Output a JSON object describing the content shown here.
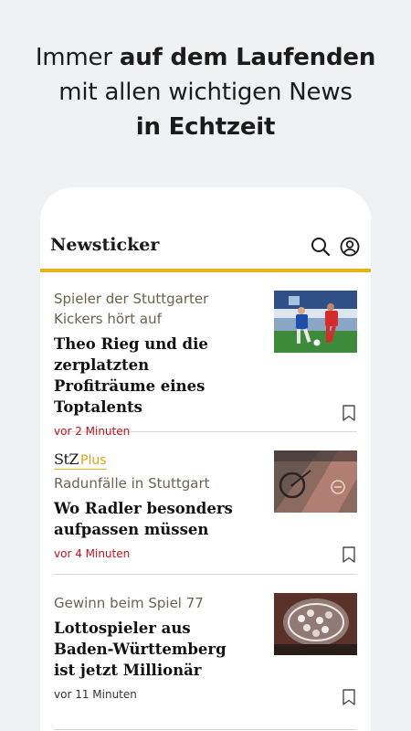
{
  "promo": {
    "line1_prefix": "Immer ",
    "line1_bold": "auf dem Laufenden",
    "line2": "mit allen wichtigen News",
    "line3_bold": "in Echtzeit"
  },
  "appbar": {
    "title": "Newsticker",
    "search_icon": "search-icon",
    "account_icon": "user-account-icon"
  },
  "colors": {
    "accent": "#e8b41e",
    "time_red": "#c4121a",
    "background": "#f0f1f3"
  },
  "articles": [
    {
      "kicker": "Spieler der Stuttgarter Kickers hört auf",
      "headline": "Theo Rieg und die zerplatzten Profiträume eines Toptalents",
      "time": "vor 2 Minuten",
      "thumbnail": "football-players-photo",
      "plus": false
    },
    {
      "badge_stz": "StZ",
      "badge_plus": "Plus",
      "kicker": "Radunfälle in Stuttgart",
      "headline": "Wo Radler besonders aufpassen müssen",
      "time": "vor 4 Minuten",
      "thumbnail": "bike-lane-photo",
      "plus": true
    },
    {
      "kicker": "Gewinn beim Spiel 77",
      "headline": "Lottospieler aus Baden-Württemberg ist jetzt Millionär",
      "time": "vor 11 Minuten",
      "thumbnail": "lottery-balls-photo",
      "plus": false
    }
  ]
}
